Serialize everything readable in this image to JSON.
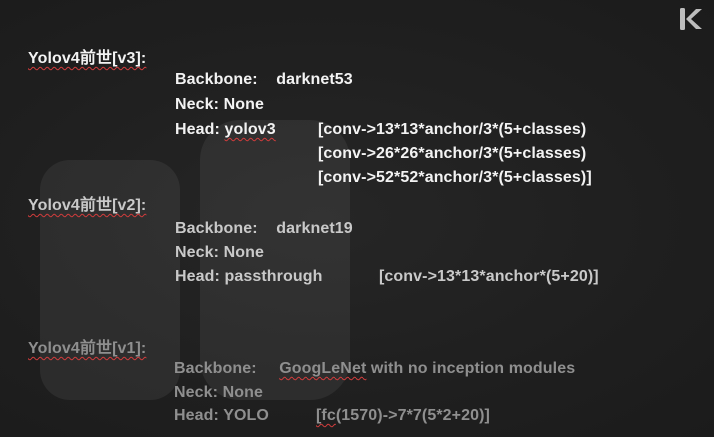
{
  "logo": {
    "icon": "k-brand-logo-icon",
    "color": "#bdbdbd"
  },
  "v3": {
    "title": "Yolov4前世[v3]:",
    "backbone_label": "Backbone:",
    "backbone_value": "darknet53",
    "neck": "Neck: None",
    "head_label": "Head:",
    "head_value": "yolov3",
    "head_items": [
      "[conv->13*13*anchor/3*(5+classes)",
      "[conv->26*26*anchor/3*(5+classes)",
      "[conv->52*52*anchor/3*(5+classes)]"
    ]
  },
  "v2": {
    "title": "Yolov4前世[v2]:",
    "backbone_label": "Backbone:",
    "backbone_value": "darknet19",
    "neck": "Neck: None",
    "head_label": "Head: passthrough",
    "head_item": "[conv->13*13*anchor*(5+20)]"
  },
  "v1": {
    "title": "Yolov4前世[v1]:",
    "backbone_label": "Backbone:",
    "backbone_value_underlined": "GoogLeNet",
    "backbone_value_rest": " with no inception modules",
    "neck": "Neck: None",
    "head_label": "Head: YOLO",
    "head_item_underlined": "[fc",
    "head_item_rest": "(1570)->7*7(5*2+20)]"
  },
  "colors": {
    "background": "#202020",
    "v3_text": "#f3f3f3",
    "v2_text": "#c9c9c9",
    "v1_text": "#8f8f8f",
    "spell_underline": "#d23c3c"
  }
}
